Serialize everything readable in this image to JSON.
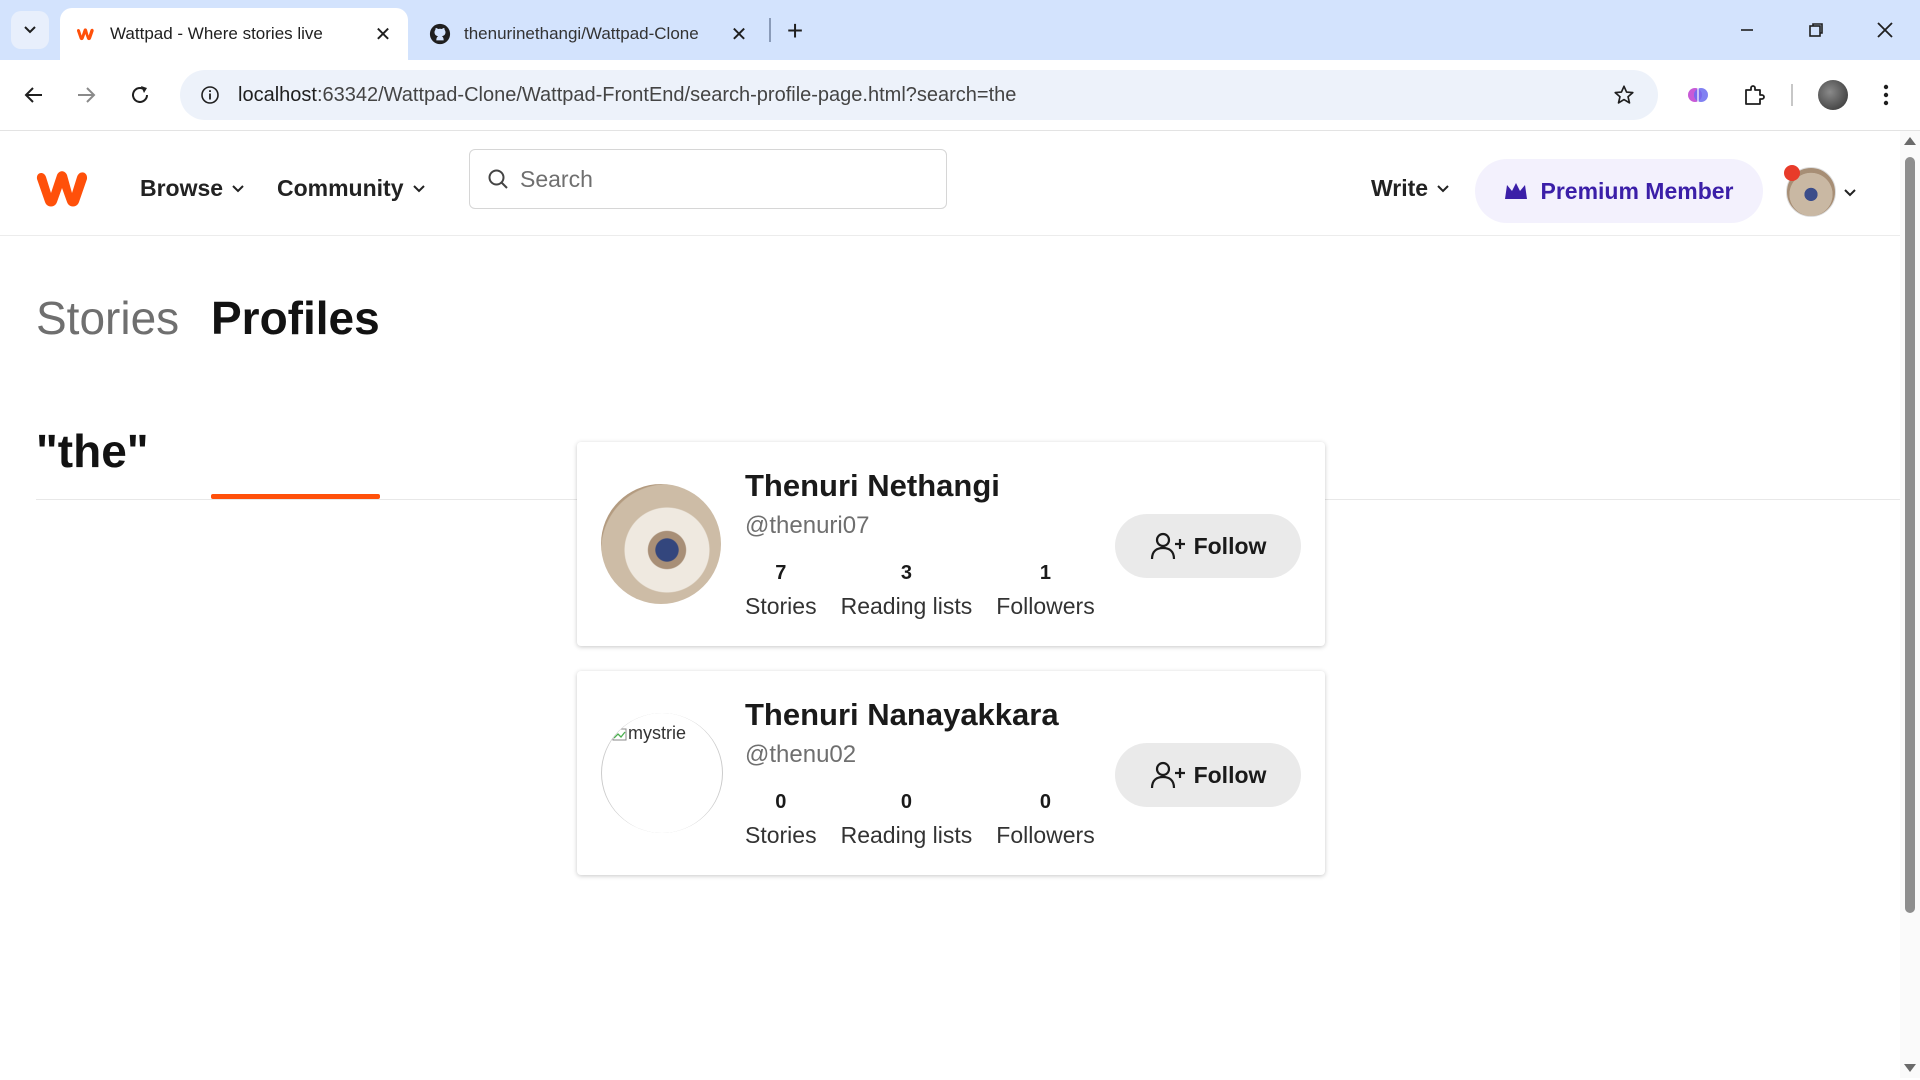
{
  "browser": {
    "tabs": [
      {
        "title": "Wattpad - Where stories live",
        "active": true,
        "favicon": "wattpad-icon"
      },
      {
        "title": "thenurinethangi/Wattpad-Clone",
        "active": false,
        "favicon": "github-icon"
      }
    ],
    "url_host": "localhost",
    "url_rest": ":63342/Wattpad-Clone/Wattpad-FrontEnd/search-profile-page.html?search=the"
  },
  "header": {
    "nav": [
      {
        "label": "Browse"
      },
      {
        "label": "Community"
      }
    ],
    "search": {
      "placeholder": "Search",
      "value": ""
    },
    "write_label": "Write",
    "premium_label": "Premium Member"
  },
  "tabs": {
    "stories": "Stories",
    "profiles": "Profiles",
    "active": "profiles"
  },
  "query_title": "\"the\"",
  "profiles": [
    {
      "name": "Thenuri Nethangi",
      "handle": "@thenuri07",
      "stats": [
        {
          "value": "7",
          "label": "Stories"
        },
        {
          "value": "3",
          "label": "Reading lists"
        },
        {
          "value": "1",
          "label": "Followers"
        }
      ],
      "follow_label": "Follow",
      "image_alt": ""
    },
    {
      "name": "Thenuri Nanayakkara",
      "handle": "@thenu02",
      "stats": [
        {
          "value": "0",
          "label": "Stories"
        },
        {
          "value": "0",
          "label": "Reading lists"
        },
        {
          "value": "0",
          "label": "Followers"
        }
      ],
      "follow_label": "Follow",
      "image_alt": "mystrie"
    }
  ],
  "colors": {
    "brand": "#ff500a",
    "premium_text": "#3b1fa8",
    "premium_bg": "#f3f1fd",
    "tabbar_bg": "#d3e3fd"
  }
}
